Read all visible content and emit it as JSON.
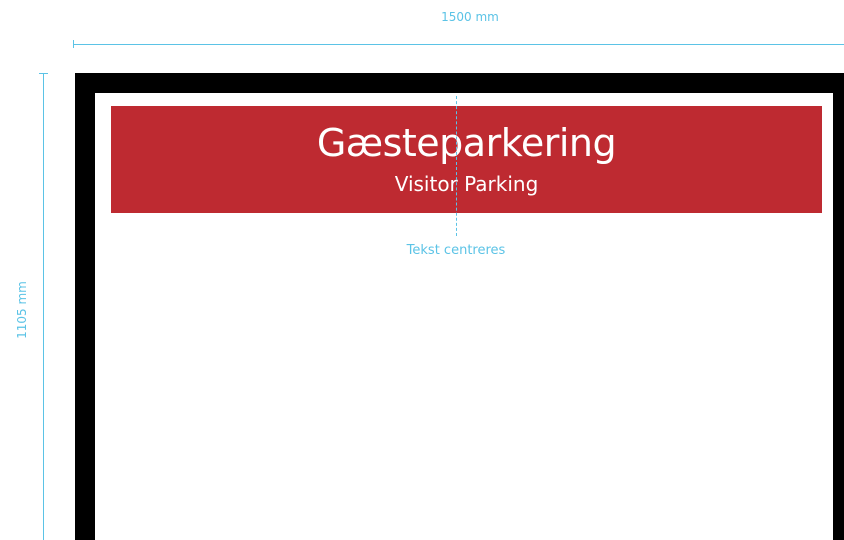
{
  "dimensions": {
    "width_label": "1500 mm",
    "height_label": "1105 mm"
  },
  "sign": {
    "title": "Gæsteparkering",
    "subtitle": "Visitor Parking",
    "center_note": "Tekst centreres"
  },
  "colors": {
    "banner": "#be2a31",
    "annotation": "#5bc3e6",
    "frame": "#000000",
    "text": "#ffffff"
  }
}
